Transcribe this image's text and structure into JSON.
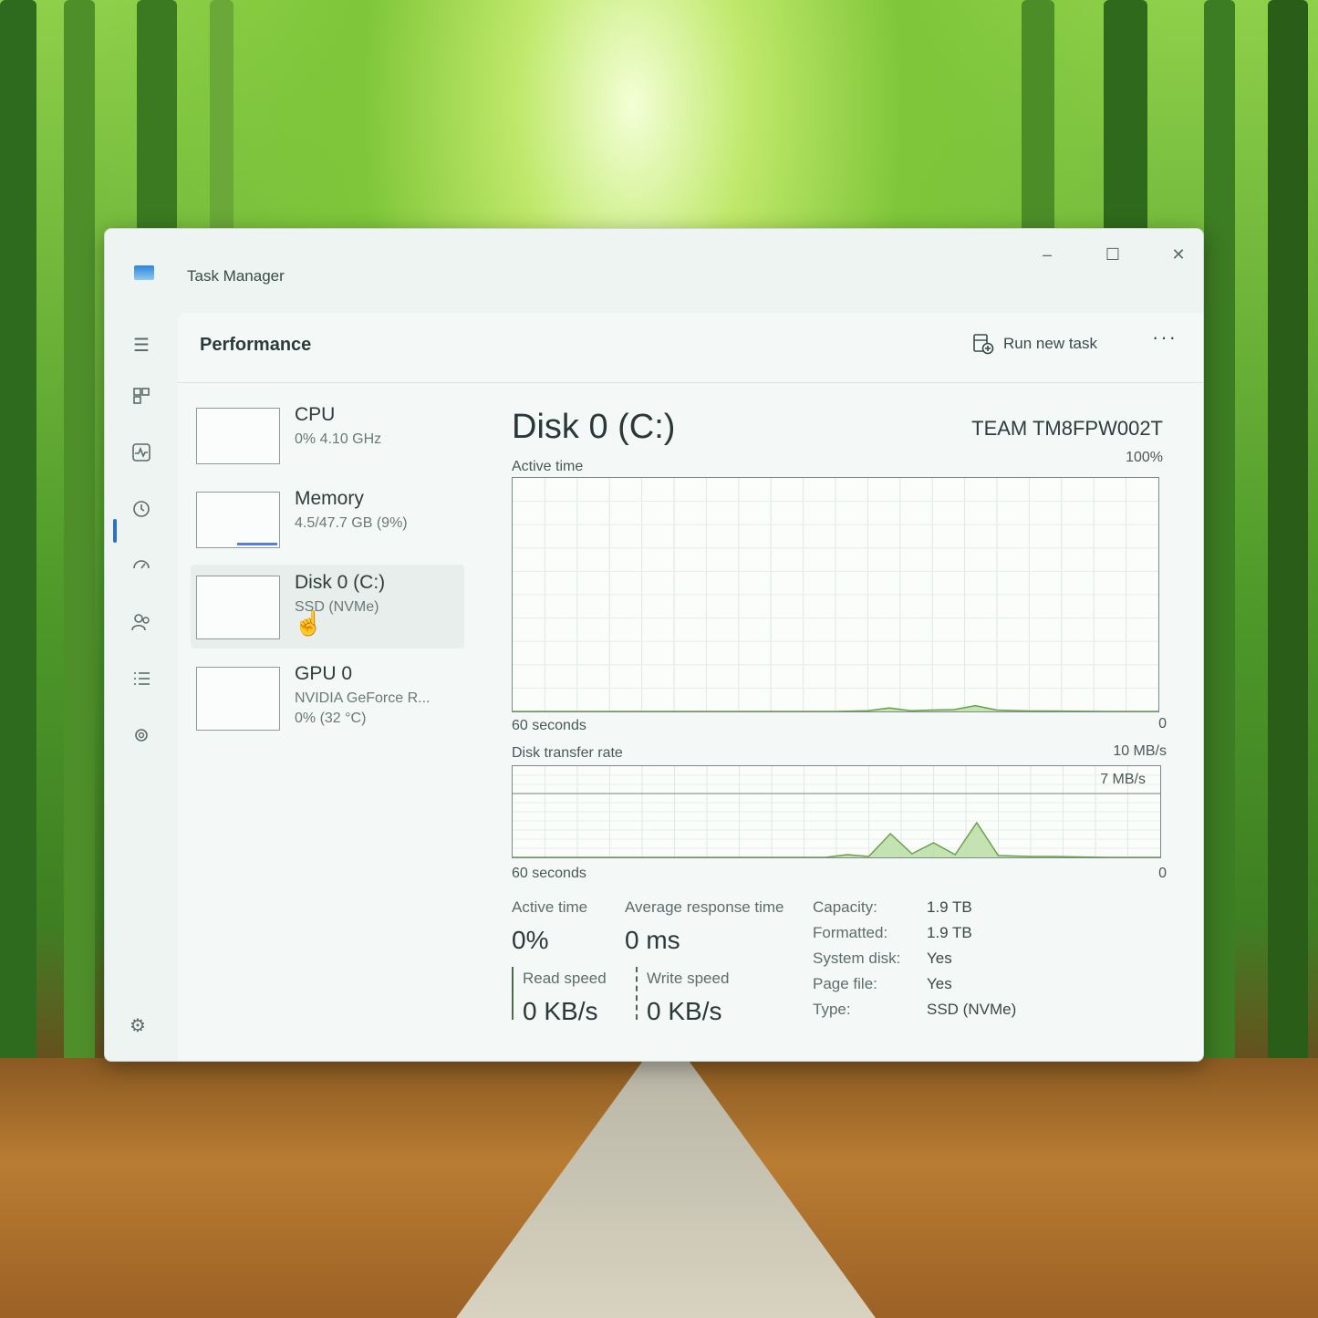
{
  "window": {
    "title": "Task Manager",
    "minimize": "–",
    "maximize": "☐",
    "close": "✕"
  },
  "nav": {
    "icons": [
      "menu-icon",
      "processes-icon",
      "performance-icon",
      "app-history-icon",
      "startup-apps-icon",
      "users-icon",
      "details-icon",
      "services-icon",
      "settings-icon"
    ],
    "selected": "performance"
  },
  "header": {
    "page_title": "Performance",
    "run_new_task": "Run new task",
    "more": "···"
  },
  "devices": [
    {
      "name": "CPU",
      "sub": "0% 4.10 GHz",
      "sub2": ""
    },
    {
      "name": "Memory",
      "sub": "4.5/47.7 GB (9%)",
      "sub2": ""
    },
    {
      "name": "Disk 0 (C:)",
      "sub": "SSD (NVMe)",
      "sub2": ""
    },
    {
      "name": "GPU 0",
      "sub": "NVIDIA GeForce R...",
      "sub2": "0% (32 °C)"
    }
  ],
  "detail": {
    "title": "Disk 0 (C:)",
    "model": "TEAM TM8FPW002T",
    "active_time_label": "Active time",
    "active_time_max": "100%",
    "active_time_x_left": "60 seconds",
    "active_time_x_right": "0",
    "transfer_label": "Disk transfer rate",
    "transfer_max": "10 MB/s",
    "transfer_inner": "7 MB/s",
    "transfer_x_left": "60 seconds",
    "transfer_x_right": "0",
    "stats": {
      "active_time_label": "Active time",
      "active_time_value": "0%",
      "avg_response_label": "Average response time",
      "avg_response_value": "0 ms",
      "read_label": "Read speed",
      "read_value": "0 KB/s",
      "write_label": "Write speed",
      "write_value": "0 KB/s"
    },
    "properties": [
      {
        "label": "Capacity:",
        "value": "1.9 TB"
      },
      {
        "label": "Formatted:",
        "value": "1.9 TB"
      },
      {
        "label": "System disk:",
        "value": "Yes"
      },
      {
        "label": "Page file:",
        "value": "Yes"
      },
      {
        "label": "Type:",
        "value": "SSD (NVMe)"
      }
    ]
  },
  "chart_data": [
    {
      "type": "area",
      "ylabel": "Active time",
      "ylim": [
        0,
        100
      ],
      "x": [
        60,
        50,
        40,
        30,
        27,
        25,
        23,
        21,
        19,
        17,
        15,
        12,
        10,
        5,
        0
      ],
      "values": [
        0,
        0,
        0,
        0,
        0.3,
        1.5,
        0.3,
        0.6,
        0.8,
        2.5,
        0.6,
        0.2,
        0.2,
        0,
        0
      ]
    },
    {
      "type": "area",
      "ylabel": "Disk transfer rate",
      "ylim": [
        0,
        10
      ],
      "x": [
        60,
        50,
        40,
        31,
        29,
        27,
        25,
        23,
        21,
        19,
        17,
        15,
        12,
        10,
        5,
        0
      ],
      "values": [
        0,
        0,
        0,
        0,
        0.3,
        0.1,
        2.6,
        0.4,
        1.6,
        0.3,
        3.8,
        0.2,
        0.1,
        0.1,
        0,
        0
      ]
    }
  ],
  "colors": {
    "accent": "#2f6fc4",
    "disk_line": "#6aa04a",
    "disk_fill": "#b8dca0"
  }
}
